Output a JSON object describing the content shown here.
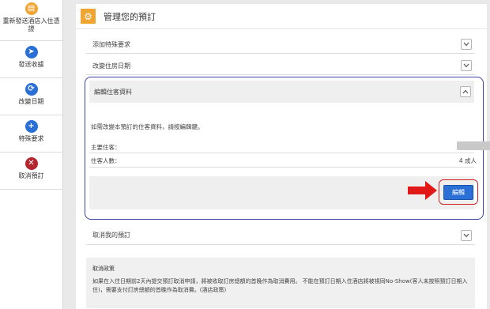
{
  "sidebar": {
    "items": [
      {
        "label": "重新發送酒店入住憑證",
        "icon": "document-icon",
        "color": "#f0a432",
        "glyph": "▤"
      },
      {
        "label": "發送收據",
        "icon": "send-icon",
        "color": "#2a6fd6",
        "glyph": "➤"
      },
      {
        "label": "改變日期",
        "icon": "refresh-icon",
        "color": "#2a6fd6",
        "glyph": "⟳"
      },
      {
        "label": "特殊要求",
        "icon": "plus-icon",
        "color": "#2a6fd6",
        "glyph": "+"
      },
      {
        "label": "取消預訂",
        "icon": "close-icon",
        "color": "#b3262e",
        "glyph": "✕"
      }
    ]
  },
  "header": {
    "title": "管理您的預訂",
    "icon": "gear-icon",
    "icon_color": "#f0a432"
  },
  "sections": {
    "special_request": "添加特殊要求",
    "change_dates": "改變住房日期",
    "edit_guest": "編輯住客資料",
    "cancel": "取消我的預訂"
  },
  "guest": {
    "info": "如需改變本預訂的住客資料，請按編輯鍵。",
    "main_guest_label": "主要住客：",
    "guest_count_label": "住客人數：",
    "guest_count_value": "4 成人",
    "edit_button": "編輯"
  },
  "policy": {
    "title": "取消政策",
    "text": "如果在入住日期前2天內提交預訂取消申請，將被收取訂房總額的首晚作為取消費用。 不能在預訂日期入住酒店將被視同No-Show(客人未按照預訂日期入住)，需要支付訂房總額的首晚作為取消費。(酒店政策)"
  },
  "colors": {
    "accent_orange": "#f0a432",
    "accent_blue": "#2a6fd6",
    "highlight_border": "#3a47a6",
    "annotation_red": "#d42020"
  }
}
